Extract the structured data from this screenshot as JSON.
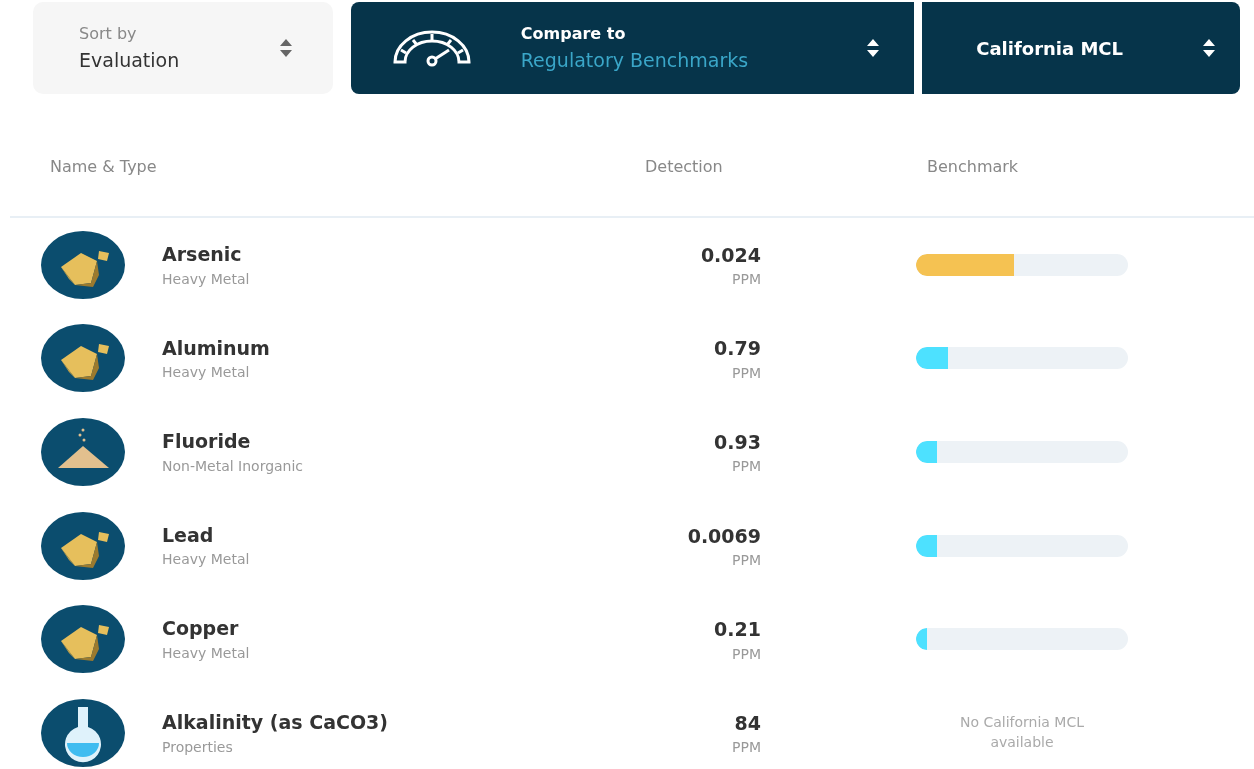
{
  "sort": {
    "label": "Sort by",
    "value": "Evaluation"
  },
  "compare": {
    "label": "Compare to",
    "value": "Regulatory Benchmarks"
  },
  "benchmark_select": {
    "value": "California MCL"
  },
  "columns": [
    "Name & Type",
    "Detection",
    "Benchmark"
  ],
  "rows": [
    {
      "kind": "rock",
      "name": "Arsenic",
      "type": "Heavy Metal",
      "value": "0.024",
      "unit": "PPM",
      "benchmark": {
        "kind": "bar",
        "level": 0.46,
        "color": "#f5c252"
      }
    },
    {
      "kind": "rock",
      "name": "Aluminum",
      "type": "Heavy Metal",
      "value": "0.79",
      "unit": "PPM",
      "benchmark": {
        "kind": "bar",
        "level": 0.15,
        "color": "#4de1ff"
      }
    },
    {
      "kind": "powder",
      "name": "Fluoride",
      "type": "Non-Metal Inorganic",
      "value": "0.93",
      "unit": "PPM",
      "benchmark": {
        "kind": "bar",
        "level": 0.1,
        "color": "#4de1ff"
      }
    },
    {
      "kind": "rock",
      "name": "Lead",
      "type": "Heavy Metal",
      "value": "0.0069",
      "unit": "PPM",
      "benchmark": {
        "kind": "bar",
        "level": 0.1,
        "color": "#4de1ff"
      }
    },
    {
      "kind": "rock",
      "name": "Copper",
      "type": "Heavy Metal",
      "value": "0.21",
      "unit": "PPM",
      "benchmark": {
        "kind": "bar",
        "level": 0.05,
        "color": "#4de1ff"
      }
    },
    {
      "kind": "flask",
      "name": "Alkalinity (as CaCO3)",
      "type": "Properties",
      "value": "84",
      "unit": "PPM",
      "benchmark": {
        "kind": "note",
        "text": "No California MCL available"
      }
    }
  ]
}
